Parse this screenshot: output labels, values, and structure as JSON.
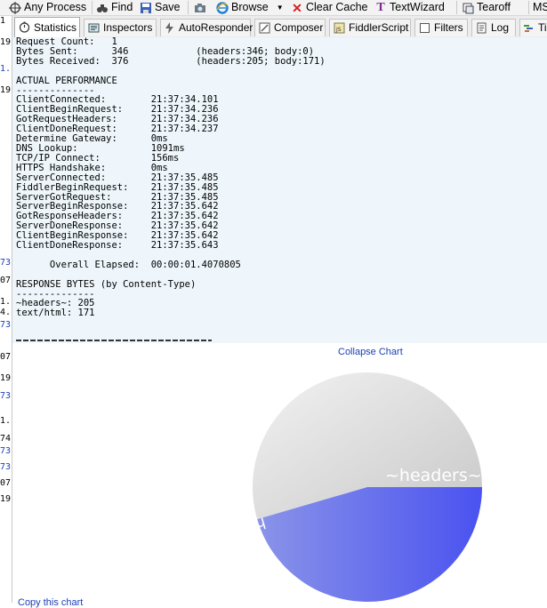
{
  "toolbar": {
    "items": [
      {
        "label": "Any Process",
        "icon": "crosshair-icon"
      },
      {
        "label": "Find",
        "icon": "binoculars-icon"
      },
      {
        "label": "Save",
        "icon": "save-icon"
      },
      {
        "label": "",
        "icon": "camera-icon"
      },
      {
        "label": "Browse",
        "icon": "ie-icon"
      },
      {
        "label": "Clear Cache",
        "icon": "clear-cache-icon"
      },
      {
        "label": "TextWizard",
        "icon": "textwizard-icon"
      },
      {
        "label": "Tearoff",
        "icon": "tearoff-icon"
      },
      {
        "label": "MS",
        "icon": ""
      }
    ]
  },
  "left_strip": {
    "lines": [
      {
        "text": "1",
        "color": "#000"
      },
      {
        "text": "19",
        "color": "#000"
      },
      {
        "text": "1.",
        "color": "#1a3eb8"
      },
      {
        "text": "19",
        "color": "#000"
      },
      {
        "text": "73",
        "color": "#1a3eb8"
      },
      {
        "text": "07",
        "color": "#000"
      },
      {
        "text": "1.",
        "color": "#000"
      },
      {
        "text": "4.",
        "color": "#000"
      },
      {
        "text": "73",
        "color": "#1a3eb8"
      },
      {
        "text": "07",
        "color": "#000"
      },
      {
        "text": "19",
        "color": "#000"
      },
      {
        "text": "73",
        "color": "#1a3eb8"
      },
      {
        "text": "1.",
        "color": "#000"
      },
      {
        "text": "74",
        "color": "#000"
      },
      {
        "text": "73",
        "color": "#1a3eb8"
      },
      {
        "text": "73",
        "color": "#1a3eb8"
      },
      {
        "text": "07",
        "color": "#000"
      },
      {
        "text": "19",
        "color": "#000"
      }
    ]
  },
  "tabs": [
    {
      "label": "Statistics",
      "icon": "stopwatch-icon",
      "active": true
    },
    {
      "label": "Inspectors",
      "icon": "inspectors-icon",
      "active": false
    },
    {
      "label": "AutoResponder",
      "icon": "lightning-icon",
      "active": false
    },
    {
      "label": "Composer",
      "icon": "composer-icon",
      "active": false
    },
    {
      "label": "FiddlerScript",
      "icon": "script-icon",
      "active": false
    },
    {
      "label": "Filters",
      "icon": "checkbox-icon",
      "active": false
    },
    {
      "label": "Log",
      "icon": "log-icon",
      "active": false
    },
    {
      "label": "Tim",
      "icon": "timeline-icon",
      "active": false
    }
  ],
  "statistics_text": "Request Count:   1\nBytes Sent:      346\t\t(headers:346; body:0)\nBytes Received:  376\t\t(headers:205; body:171)\n\nACTUAL PERFORMANCE\n--------------\nClientConnected:\t21:37:34.101\nClientBeginRequest:\t21:37:34.236\nGotRequestHeaders:\t21:37:34.236\nClientDoneRequest:\t21:37:34.237\nDetermine Gateway:\t0ms\nDNS Lookup: \t\t1091ms\nTCP/IP Connect:\t\t156ms\nHTTPS Handshake:\t0ms\nServerConnected:\t21:37:35.485\nFiddlerBeginRequest:\t21:37:35.485\nServerGotRequest:\t21:37:35.485\nServerBeginResponse:\t21:37:35.642\nGotResponseHeaders:\t21:37:35.642\nServerDoneResponse:\t21:37:35.642\nClientBeginResponse:\t21:37:35.642\nClientDoneResponse:\t21:37:35.643\n\n      Overall Elapsed:\t00:00:01.4070805\n\nRESPONSE BYTES (by Content-Type)\n--------------\n~headers~: 205\ntext/html: 171",
  "chart": {
    "collapse_label": "Collapse Chart",
    "copy_label": "Copy this chart",
    "slices": [
      {
        "label": "~headers~",
        "value": 205,
        "color_from": "#f2f2f2",
        "color_to": "#c8c8c8"
      },
      {
        "label": "html",
        "value": 171,
        "color_from": "#8a94e8",
        "color_to": "#4a52f0"
      }
    ]
  },
  "chart_data": {
    "type": "pie",
    "title": "",
    "categories": [
      "~headers~",
      "html"
    ],
    "values": [
      205,
      171
    ]
  }
}
